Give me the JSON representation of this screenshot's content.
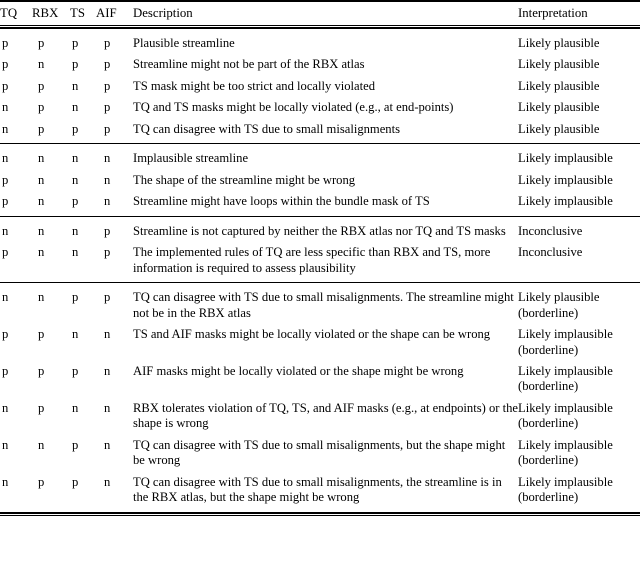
{
  "table": {
    "columns": [
      {
        "key": "tq",
        "label": "TQ"
      },
      {
        "key": "rbx",
        "label": "RBX"
      },
      {
        "key": "ts",
        "label": "TS"
      },
      {
        "key": "aif",
        "label": "AIF"
      },
      {
        "key": "description",
        "label": "Description"
      },
      {
        "key": "interpretation",
        "label": "Interpretation"
      }
    ],
    "groups": [
      {
        "name": "likely-plausible-group",
        "rows": [
          {
            "tq": "p",
            "rbx": "p",
            "ts": "p",
            "aif": "p",
            "description": "Plausible streamline",
            "interpretation": "Likely plausible",
            "interpretation2": ""
          },
          {
            "tq": "p",
            "rbx": "n",
            "ts": "p",
            "aif": "p",
            "description": "Streamline might not be part of the RBX atlas",
            "interpretation": "Likely plausible",
            "interpretation2": ""
          },
          {
            "tq": "p",
            "rbx": "p",
            "ts": "n",
            "aif": "p",
            "description": "TS mask might be too strict and locally violated",
            "interpretation": "Likely plausible",
            "interpretation2": ""
          },
          {
            "tq": "n",
            "rbx": "p",
            "ts": "n",
            "aif": "p",
            "description": "TQ and TS masks might be locally violated (e.g., at end-points)",
            "interpretation": "Likely plausible",
            "interpretation2": ""
          },
          {
            "tq": "n",
            "rbx": "p",
            "ts": "p",
            "aif": "p",
            "description": "TQ can disagree with TS due to small misalignments",
            "interpretation": "Likely plausible",
            "interpretation2": ""
          }
        ]
      },
      {
        "name": "likely-implausible-group",
        "rows": [
          {
            "tq": "n",
            "rbx": "n",
            "ts": "n",
            "aif": "n",
            "description": "Implausible streamline",
            "interpretation": "Likely implausible",
            "interpretation2": ""
          },
          {
            "tq": "p",
            "rbx": "n",
            "ts": "n",
            "aif": "n",
            "description": "The shape of the streamline might be wrong",
            "interpretation": "Likely implausible",
            "interpretation2": ""
          },
          {
            "tq": "p",
            "rbx": "n",
            "ts": "p",
            "aif": "n",
            "description": "Streamline might have loops within the bundle mask of TS",
            "interpretation": "Likely implausible",
            "interpretation2": ""
          }
        ]
      },
      {
        "name": "inconclusive-group",
        "rows": [
          {
            "tq": "n",
            "rbx": "n",
            "ts": "n",
            "aif": "p",
            "description": "Streamline is not captured by neither the RBX atlas nor TQ and TS masks",
            "interpretation": "Inconclusive",
            "interpretation2": ""
          },
          {
            "tq": "p",
            "rbx": "n",
            "ts": "n",
            "aif": "p",
            "description": "The implemented rules of TQ are less specific than RBX and TS, more information is required to assess plausibility",
            "interpretation": "Inconclusive",
            "interpretation2": ""
          }
        ]
      },
      {
        "name": "borderline-group",
        "rows": [
          {
            "tq": "n",
            "rbx": "n",
            "ts": "p",
            "aif": "p",
            "description": "TQ can disagree with TS due to small misalignments. The streamline might not be in the RBX atlas",
            "interpretation": "Likely plausible",
            "interpretation2": "(borderline)"
          },
          {
            "tq": "p",
            "rbx": "p",
            "ts": "n",
            "aif": "n",
            "description": "TS and AIF masks might be locally violated or the shape can be wrong",
            "interpretation": "Likely implausible",
            "interpretation2": "(borderline)"
          },
          {
            "tq": "p",
            "rbx": "p",
            "ts": "p",
            "aif": "n",
            "description": "AIF masks might be locally violated or the shape might be wrong",
            "interpretation": "Likely implausible",
            "interpretation2": "(borderline)"
          },
          {
            "tq": "n",
            "rbx": "p",
            "ts": "n",
            "aif": "n",
            "description": "RBX tolerates violation of TQ, TS, and AIF masks (e.g., at endpoints) or the shape is wrong",
            "interpretation": "Likely implausible",
            "interpretation2": "(borderline)"
          },
          {
            "tq": "n",
            "rbx": "n",
            "ts": "p",
            "aif": "n",
            "description": "TQ can disagree with TS due to small misalignments, but the shape might be wrong",
            "interpretation": "Likely implausible",
            "interpretation2": "(borderline)"
          },
          {
            "tq": "n",
            "rbx": "p",
            "ts": "p",
            "aif": "n",
            "description": "TQ can disagree with TS due to small misalignments, the streamline is in the RBX atlas, but the shape might be wrong",
            "interpretation": "Likely implausible",
            "interpretation2": "(borderline)"
          }
        ]
      }
    ]
  }
}
